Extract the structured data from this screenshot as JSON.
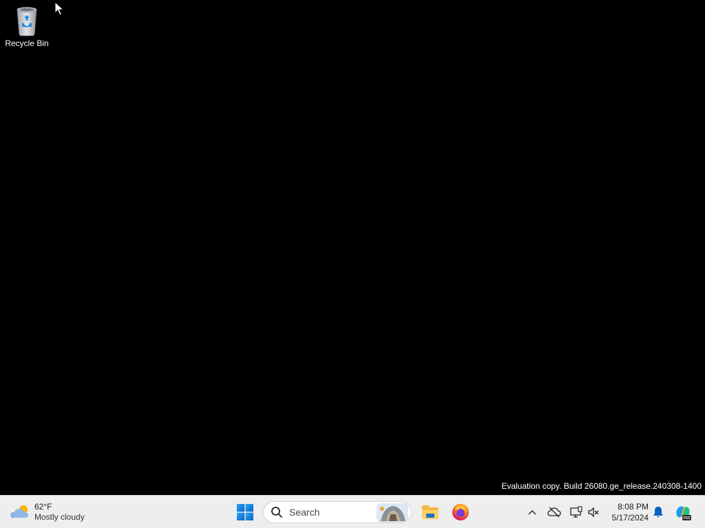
{
  "desktop": {
    "icons": [
      {
        "label": "Recycle Bin",
        "icon": "recycle-bin-icon"
      }
    ],
    "watermark": "Evaluation copy. Build 26080.ge_release.240308-1400"
  },
  "taskbar": {
    "weather": {
      "temperature": "62°F",
      "condition": "Mostly cloudy",
      "icon": "cloud-sun-icon"
    },
    "start": {
      "icon": "windows-logo-icon"
    },
    "search": {
      "placeholder": "Search",
      "icon": "search-icon"
    },
    "pinned_apps": [
      {
        "name": "File Explorer",
        "icon": "folder-icon"
      },
      {
        "name": "Firefox",
        "icon": "firefox-icon"
      }
    ],
    "tray": {
      "icons": [
        "chevron-up-icon",
        "onedrive-off-icon",
        "network-icon",
        "volume-muted-icon"
      ]
    },
    "clock": {
      "time": "8:08 PM",
      "date": "5/17/2024"
    },
    "notification_icon": "bell-icon",
    "copilot_icon": "copilot-icon"
  },
  "colors": {
    "desktop_bg": "#000000",
    "taskbar_bg": "#eeeeee",
    "accent": "#0078d4"
  }
}
